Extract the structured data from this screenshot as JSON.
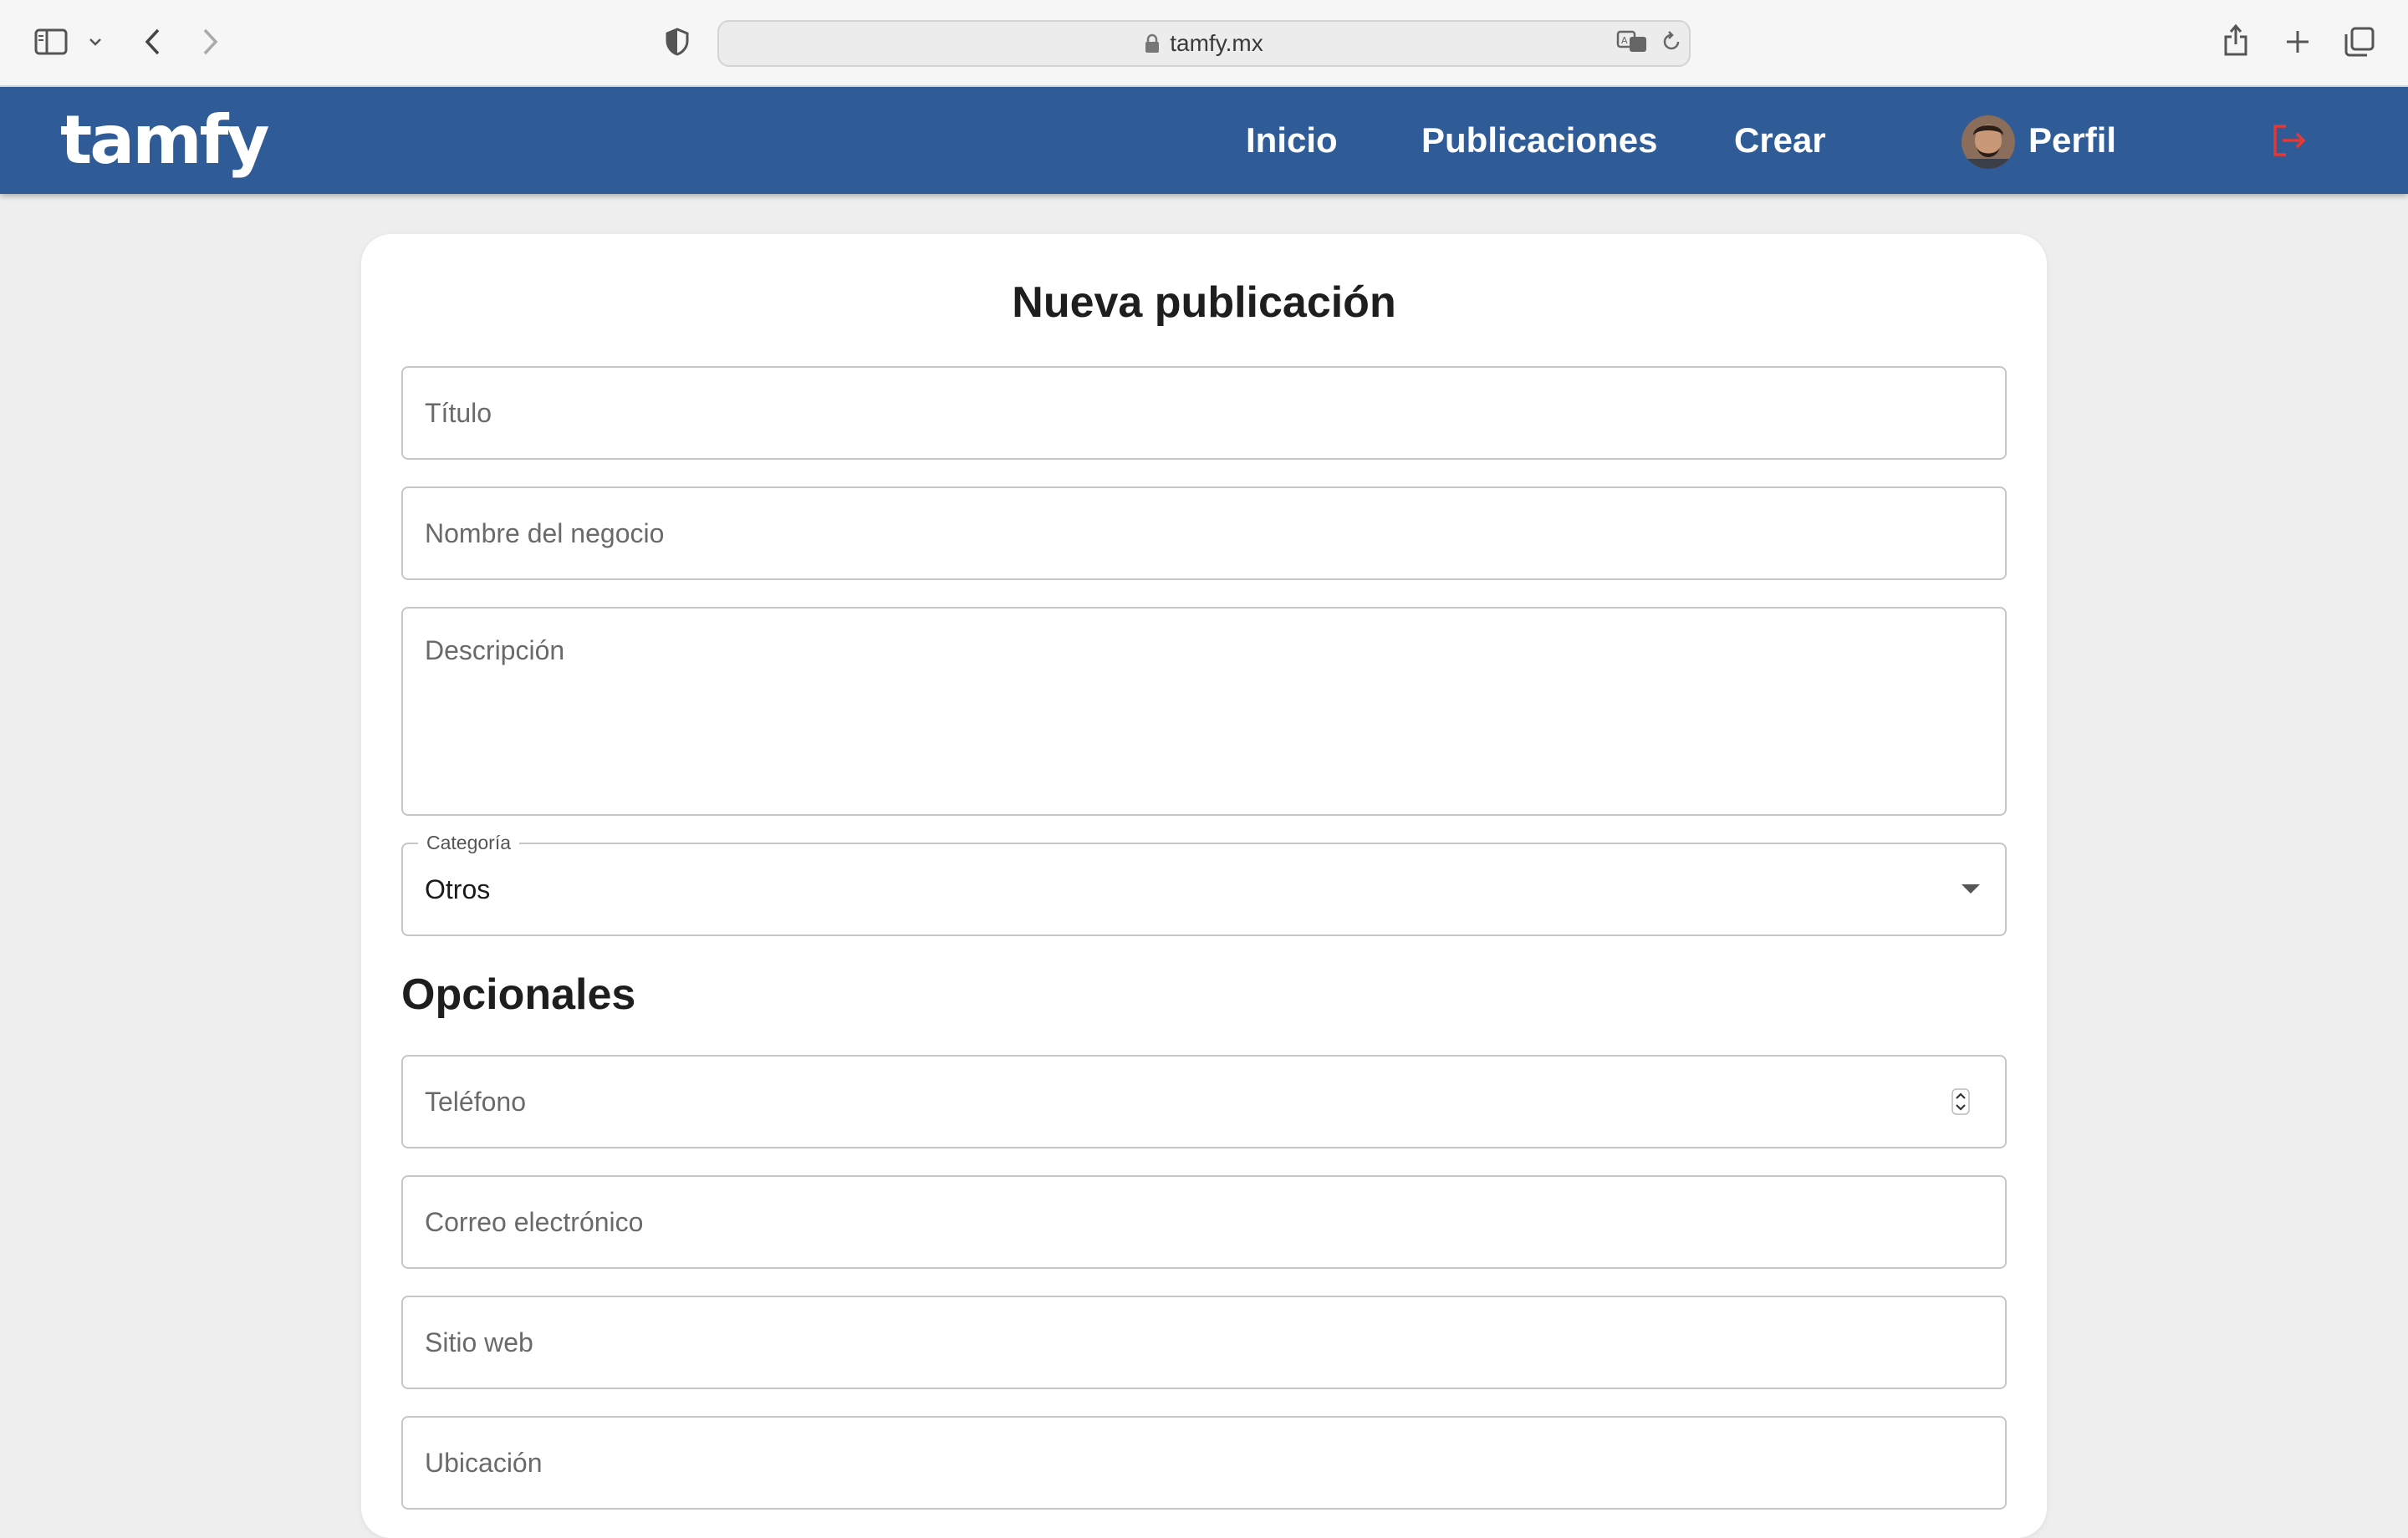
{
  "browser": {
    "url": "tamfy.mx",
    "icons": {
      "sidebar": "sidebar-icon",
      "sidebar_menu": "chevron-down-icon",
      "back": "chevron-left-icon",
      "forward": "chevron-right-icon",
      "privacy": "shield-icon",
      "lock": "lock-icon",
      "translate": "translate-icon",
      "reload": "reload-icon",
      "share": "share-icon",
      "new_tab": "plus-icon",
      "tabs": "tabs-overview-icon"
    }
  },
  "header": {
    "logo": "tamfy",
    "nav": {
      "home": "Inicio",
      "posts": "Publicaciones",
      "create": "Crear",
      "profile": "Perfil"
    },
    "logout_icon": "logout-icon",
    "colors": {
      "background": "#2f5b97",
      "logout": "#e53935"
    }
  },
  "form": {
    "title": "Nueva publicación",
    "fields": {
      "title_placeholder": "Título",
      "business_placeholder": "Nombre del negocio",
      "description_placeholder": "Descripción",
      "category_label": "Categoría",
      "category_value": "Otros"
    },
    "optional_title": "Opcionales",
    "optional": {
      "phone_placeholder": "Teléfono",
      "email_placeholder": "Correo electrónico",
      "website_placeholder": "Sitio web",
      "location_placeholder": "Ubicación"
    }
  }
}
